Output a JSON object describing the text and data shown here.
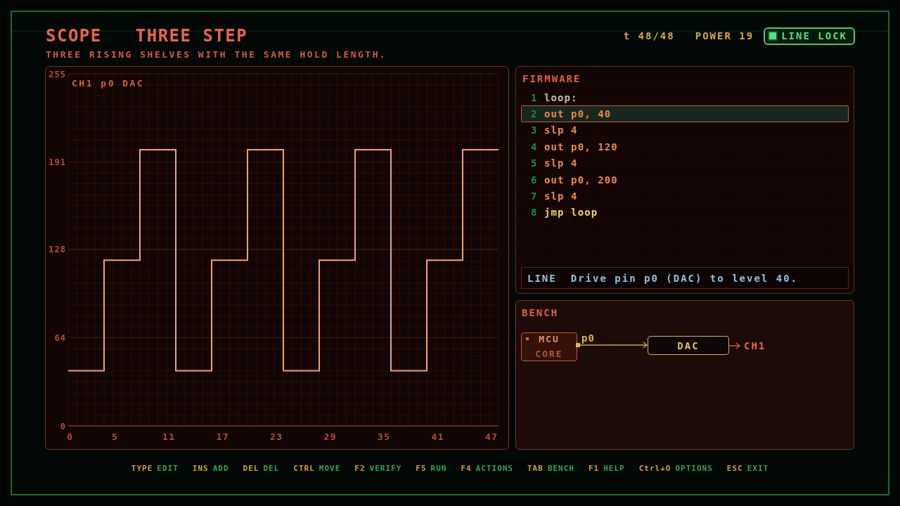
{
  "header": {
    "title": "SCOPE",
    "level_name": "THREE STEP",
    "subtitle": "THREE RISING SHELVES WITH THE SAME HOLD LENGTH.",
    "time": "t 48/48",
    "power": "POWER 19",
    "line_lock": {
      "label": "LINE LOCK",
      "on": true
    }
  },
  "scope": {
    "chart_data": {
      "type": "line",
      "x": [
        0,
        4,
        4,
        8,
        8,
        12,
        12,
        16,
        16,
        20,
        20,
        24,
        24,
        28,
        28,
        32,
        32,
        36,
        36,
        40,
        40,
        44,
        44,
        48
      ],
      "series": [
        {
          "name": "CH1 p0 DAC",
          "color": "#f4a070",
          "values": [
            40,
            40,
            120,
            120,
            200,
            200,
            40,
            40,
            120,
            120,
            200,
            200,
            40,
            40,
            120,
            120,
            200,
            200,
            40,
            40,
            120,
            120,
            200,
            200
          ]
        }
      ],
      "xlim": [
        0,
        48
      ],
      "ylim": [
        0,
        255
      ],
      "xticks": [
        0,
        5,
        11,
        17,
        23,
        29,
        35,
        41,
        47
      ],
      "yticks": [
        0,
        64,
        128,
        191,
        255
      ],
      "grid": true
    }
  },
  "firmware": {
    "title": "FIRMWARE",
    "lines": [
      {
        "number": "1",
        "code": "loop:",
        "kind": "label",
        "selected": false
      },
      {
        "number": "2",
        "code": "out p0, 40",
        "kind": "op",
        "selected": true
      },
      {
        "number": "3",
        "code": "slp 4",
        "kind": "op",
        "selected": false
      },
      {
        "number": "4",
        "code": "out p0, 120",
        "kind": "op",
        "selected": false
      },
      {
        "number": "5",
        "code": "slp 4",
        "kind": "op",
        "selected": false
      },
      {
        "number": "6",
        "code": "out p0, 200",
        "kind": "op",
        "selected": false
      },
      {
        "number": "7",
        "code": "slp 4",
        "kind": "op",
        "selected": false
      },
      {
        "number": "8",
        "code": "jmp loop",
        "kind": "jump",
        "selected": false
      }
    ],
    "info": {
      "tag": "LINE",
      "text": "Drive pin p0 (DAC) to level 40."
    }
  },
  "bench": {
    "title": "BENCH",
    "source": {
      "label": "MCU",
      "sublabel": "CORE",
      "port": "p0"
    },
    "device": {
      "label": "DAC"
    },
    "output": {
      "label": "CH1"
    }
  },
  "footer": {
    "hints": [
      {
        "key": "TYPE",
        "action": "EDIT"
      },
      {
        "key": "INS",
        "action": "ADD"
      },
      {
        "key": "DEL",
        "action": "DEL"
      },
      {
        "key": "CTRL",
        "action": "MOVE"
      },
      {
        "key": "F2",
        "action": "VERIFY"
      },
      {
        "key": "F5",
        "action": "RUN"
      },
      {
        "key": "F4",
        "action": "ACTIONS"
      },
      {
        "key": "TAB",
        "action": "BENCH"
      },
      {
        "key": "F1",
        "action": "HELP"
      },
      {
        "key": "Ctrl+O",
        "action": "OPTIONS"
      },
      {
        "key": "ESC",
        "action": "EXIT"
      }
    ]
  }
}
